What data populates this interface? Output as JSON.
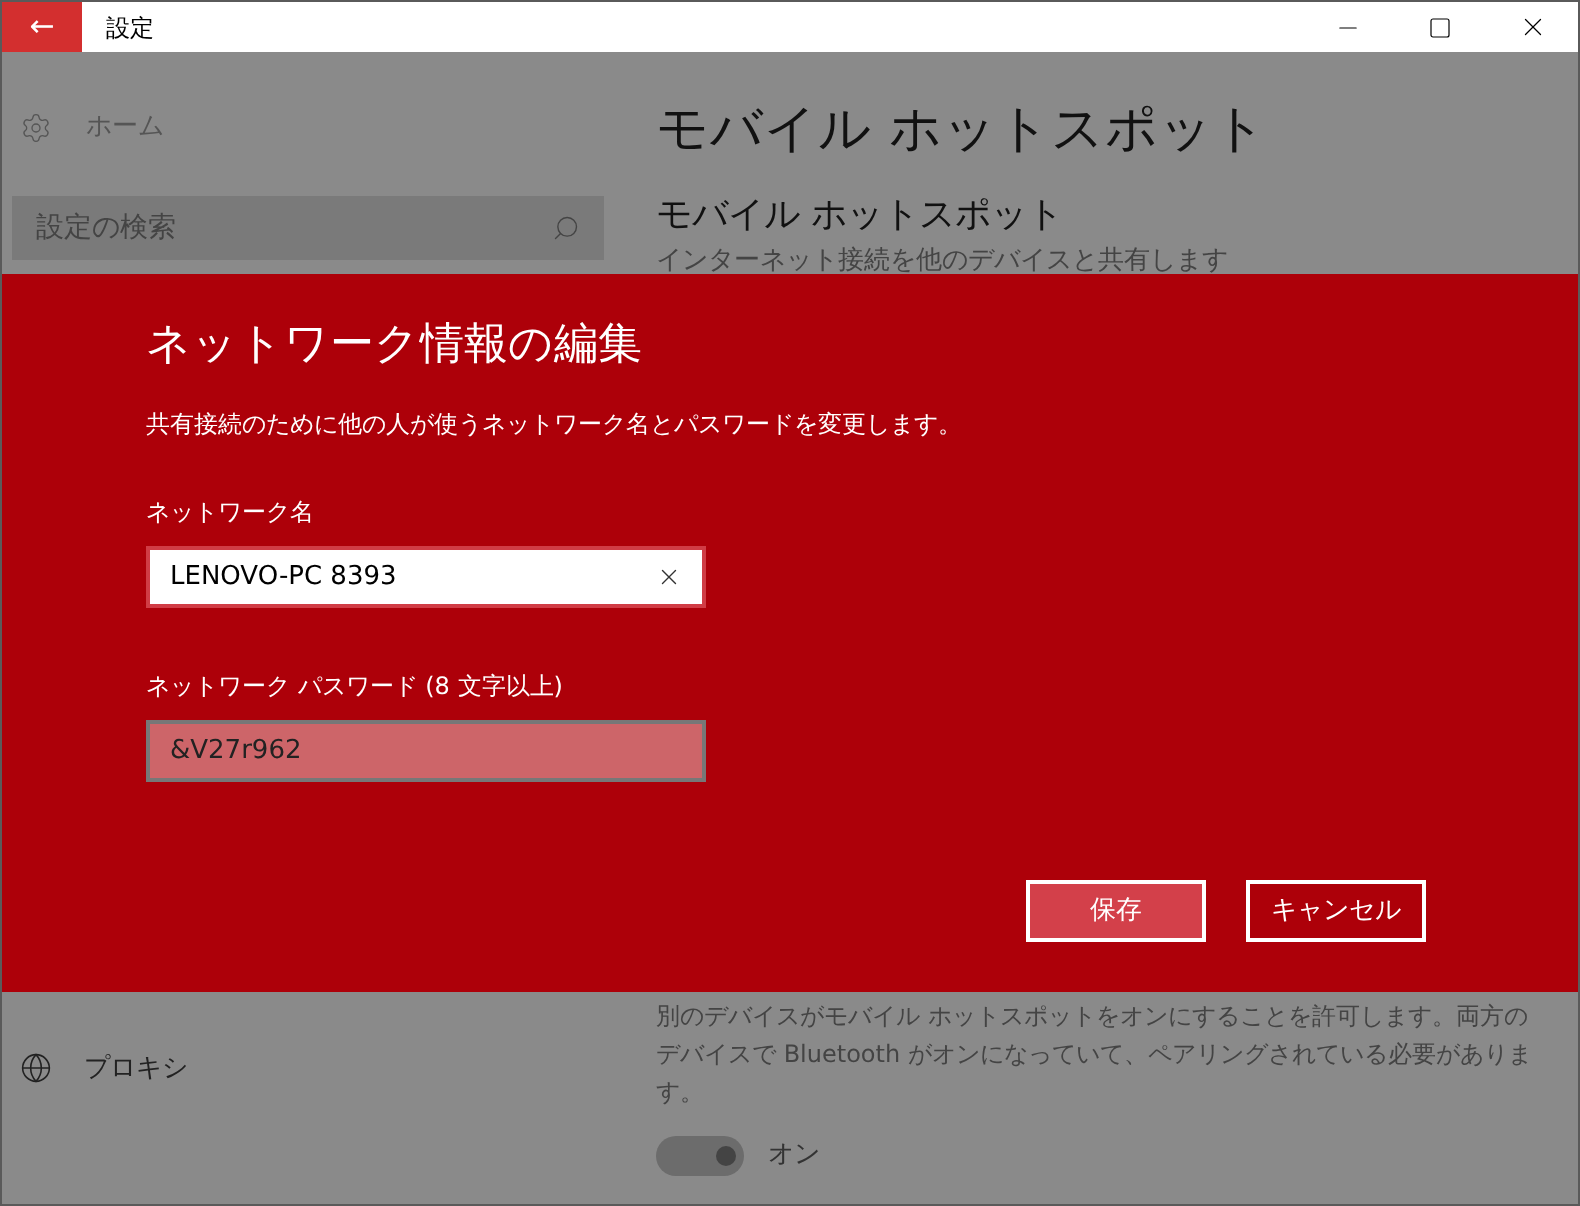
{
  "window": {
    "title": "設定",
    "back": "←"
  },
  "sidebar": {
    "home": "ホーム",
    "search": {
      "placeholder": "設定の検索"
    },
    "items": [
      {
        "label": "プロキシ"
      }
    ]
  },
  "page": {
    "title": "モバイル ホットスポット",
    "section": "モバイル ホットスポット",
    "section_desc": "インターネット接続を他のデバイスと共有します",
    "bluetooth_desc": "別のデバイスがモバイル ホットスポットをオンにすることを許可します。両方のデバイスで Bluetooth がオンになっていて、ペアリングされている必要があります。",
    "toggle": {
      "on": true,
      "label": "オン"
    }
  },
  "dialog": {
    "title": "ネットワーク情報の編集",
    "description": "共有接続のために他の人が使うネットワーク名とパスワードを変更します。",
    "fields": [
      {
        "label": "ネットワーク名",
        "value": "LENOVO-PC 8393",
        "focused": true
      },
      {
        "label": "ネットワーク パスワード (8 文字以上)",
        "value": "&V27r962",
        "focused": false
      }
    ],
    "buttons": [
      {
        "label": "保存",
        "kind": "primary"
      },
      {
        "label": "キャンセル",
        "kind": "secondary"
      }
    ]
  }
}
